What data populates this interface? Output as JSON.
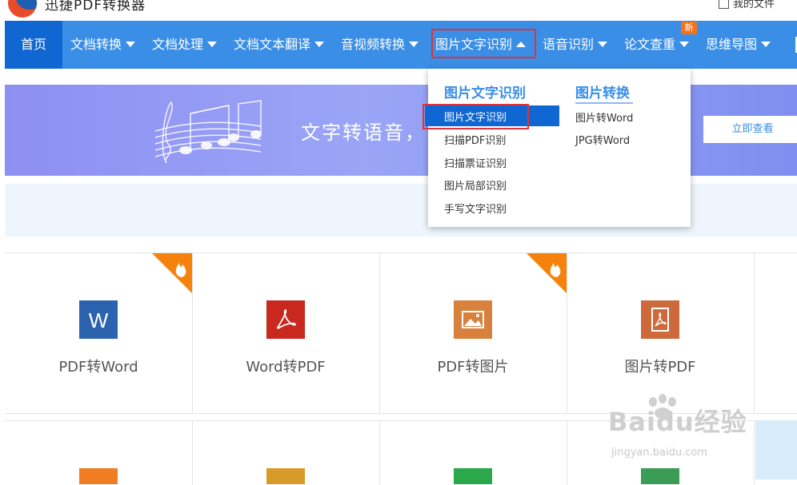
{
  "header": {
    "brand": "迅捷PDF转换器",
    "my_files": "我的文件"
  },
  "nav": {
    "items": [
      "首页",
      "文档转换",
      "文档处理",
      "文档文本翻译",
      "音视频转换",
      "图片文字识别",
      "语音识别",
      "论文查重",
      "思维导图"
    ],
    "badge": "新",
    "active_index": 0,
    "open_index": 5
  },
  "dropdown": {
    "col1_title": "图片文字识别",
    "col1_items": [
      "图片文字识别",
      "扫描PDF识别",
      "扫描票证识别",
      "图片局部识别",
      "手写文字识别"
    ],
    "col2_title": "图片转换",
    "col2_items": [
      "图片转Word",
      "JPG转Word"
    ]
  },
  "banner": {
    "text": "文字转语音，",
    "button": "立即查看"
  },
  "tools": [
    {
      "label": "PDF转Word",
      "icon": "word-icon",
      "color": "#2b63ae",
      "hot": true
    },
    {
      "label": "Word转PDF",
      "icon": "pdf-icon",
      "color": "#c8281e",
      "hot": false
    },
    {
      "label": "PDF转图片",
      "icon": "image-icon",
      "color": "#d8813d",
      "hot": true
    },
    {
      "label": "图片转PDF",
      "icon": "pdf-icon",
      "color": "#cd6a3c",
      "hot": false
    }
  ],
  "watermark": {
    "brand": "Baidu经验",
    "url": "jingyan.baidu.com"
  },
  "colors": {
    "nav_bg": "#3a8ee6",
    "nav_active": "#1067d2",
    "highlight_border": "#e0323a",
    "hot_badge": "#f5820d"
  }
}
